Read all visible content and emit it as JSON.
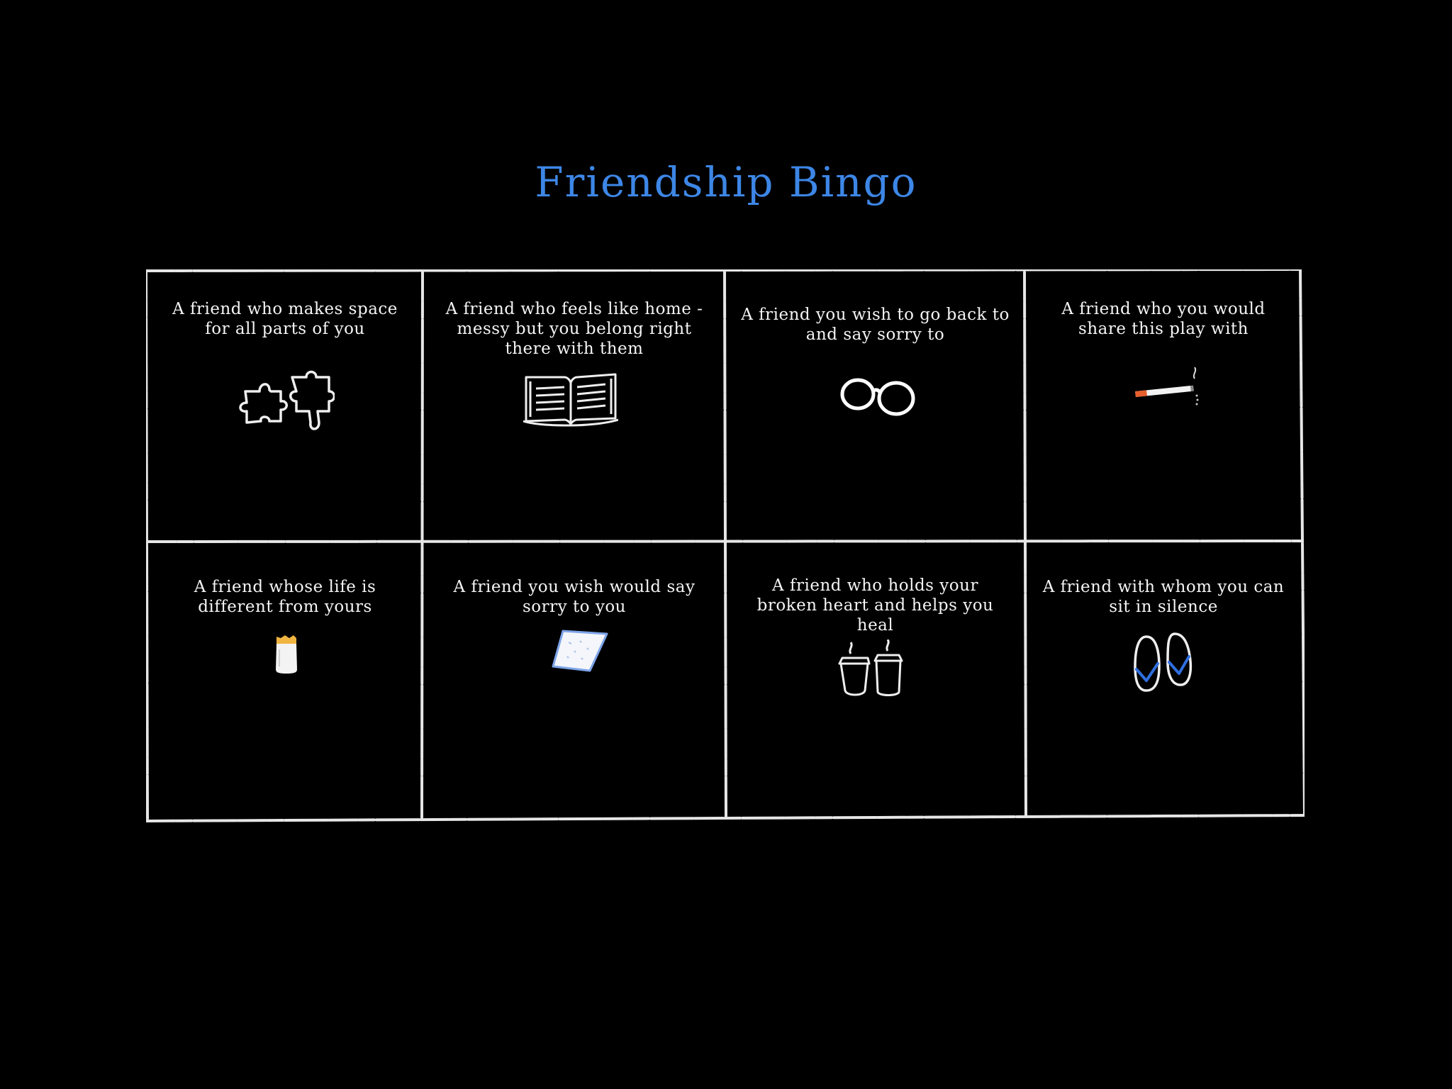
{
  "title": "Friendship Bingo",
  "colors": {
    "background": "#000000",
    "title": "#3d86e6",
    "chalk": "#e8e8e8",
    "accent_blue": "#2f6fe0",
    "cigarette_tip": "#e8602c",
    "jar_lid": "#f0b440"
  },
  "cells": [
    {
      "text": "A friend who makes space for all parts of you",
      "icon": "puzzle-pieces-icon"
    },
    {
      "text": "A friend who feels like home - messy but you belong right there with them",
      "icon": "open-book-icon"
    },
    {
      "text": "A friend you wish to go back to and say sorry to",
      "icon": "glasses-icon"
    },
    {
      "text": "A friend who you would share this play with",
      "icon": "cigarette-icon"
    },
    {
      "text": "A friend whose life is different from yours",
      "icon": "jar-icon"
    },
    {
      "text": "A friend you wish would say sorry to you",
      "icon": "handkerchief-icon"
    },
    {
      "text": "A friend who holds your broken heart and helps you heal",
      "icon": "coffee-cups-icon"
    },
    {
      "text": "A friend with whom you can sit in silence",
      "icon": "flip-flops-icon"
    }
  ]
}
